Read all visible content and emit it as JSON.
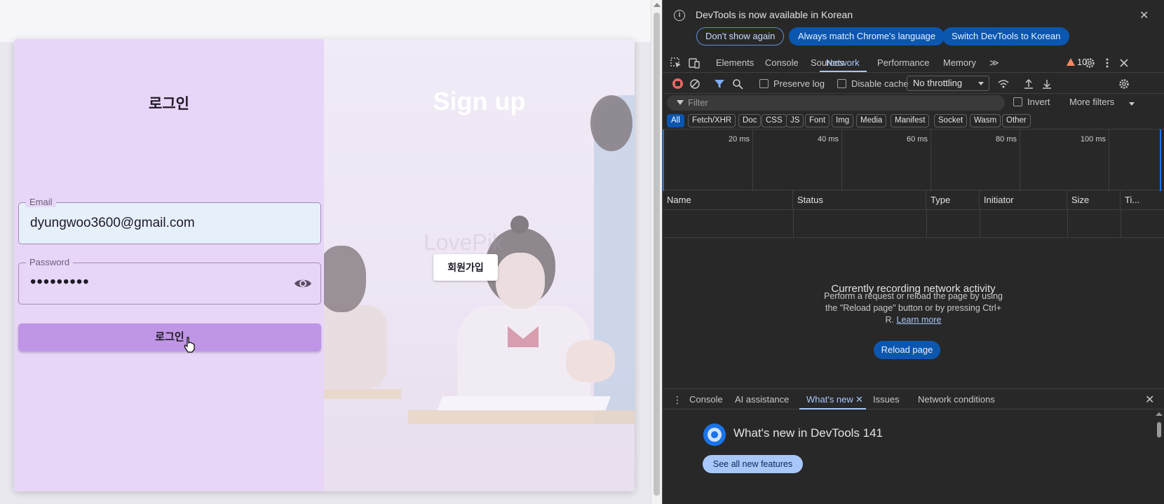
{
  "page": {
    "login": {
      "title": "로그인",
      "email_label": "Email",
      "email_value": "dyungwoo3600@gmail.com",
      "password_label": "Password",
      "password_value": "•••••••••",
      "login_button": "로그인"
    },
    "signup": {
      "title": "Sign up",
      "button": "회원가입",
      "watermark": "LovePik"
    }
  },
  "devtools": {
    "infobar": {
      "message": "DevTools is now available in Korean",
      "buttons": [
        "Don't show again",
        "Always match Chrome's language",
        "Switch DevTools to Korean"
      ]
    },
    "tabs": [
      "Elements",
      "Console",
      "Sources",
      "Network",
      "Performance",
      "Memory"
    ],
    "active_tab": "Network",
    "more_tabs": "≫",
    "warning_count": "10",
    "toolbar": {
      "preserve_log": "Preserve log",
      "disable_cache": "Disable cache",
      "throttling": "No throttling"
    },
    "filter": {
      "placeholder": "Filter",
      "invert": "Invert",
      "more_filters": "More filters"
    },
    "type_filters": [
      "All",
      "Fetch/XHR",
      "Doc",
      "CSS",
      "JS",
      "Font",
      "Img",
      "Media",
      "Manifest",
      "Socket",
      "Wasm",
      "Other"
    ],
    "timeline_ticks": [
      "20 ms",
      "40 ms",
      "60 ms",
      "80 ms",
      "100 ms"
    ],
    "columns": [
      "Name",
      "Status",
      "Type",
      "Initiator",
      "Size",
      "Ti..."
    ],
    "empty_state": {
      "title": "Currently recording network activity",
      "line1": "Perform a request or reload the page by using",
      "line2": "the \"Reload page\" button or by pressing Ctrl+",
      "line3_prefix": "R.",
      "learn_more": "Learn more",
      "reload_button": "Reload page"
    },
    "drawer": {
      "tabs": [
        "Console",
        "AI assistance",
        "What's new",
        "Issues",
        "Network conditions"
      ],
      "active_tab": "What's new",
      "whats_new_title": "What's new in DevTools 141",
      "see_all": "See all new features"
    }
  },
  "colors": {
    "login_panel": "#e8d6f8",
    "login_button": "#bf96e6",
    "devtools_bg": "#282828",
    "devtools_accent": "#a8c7fa",
    "primary_blue": "#0b57b0"
  }
}
